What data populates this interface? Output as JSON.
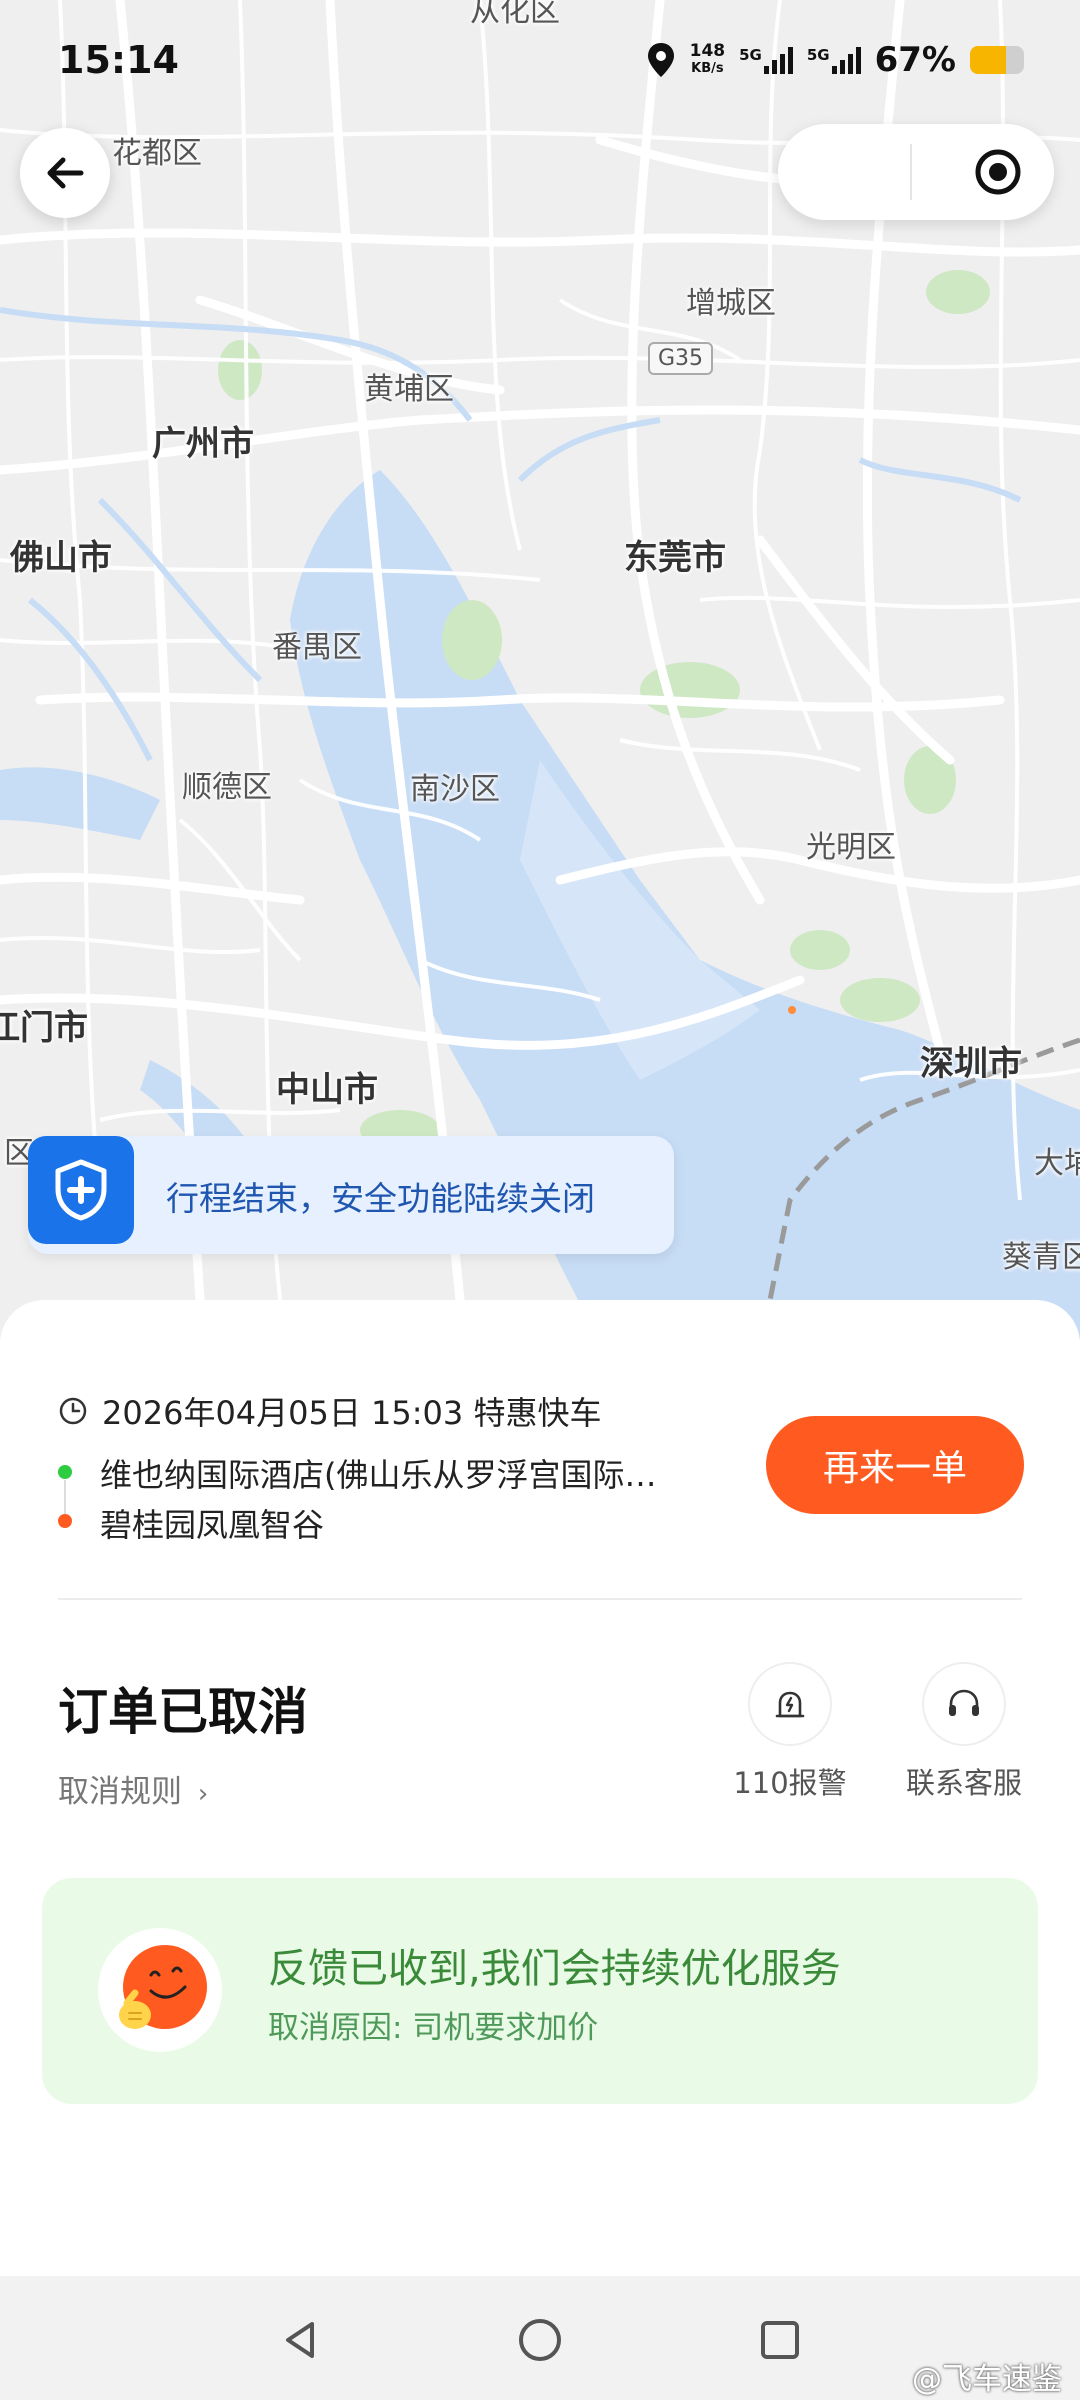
{
  "status_bar": {
    "time": "15:14",
    "net_speed_value": "148",
    "net_speed_unit": "KB/s",
    "sim1_label": "5G",
    "sim2_label": "5G",
    "battery_percent_text": "67%",
    "battery_level": 0.67,
    "battery_color": "#f7b500"
  },
  "map": {
    "labels": {
      "huadu": "花都区",
      "huadu_top": "从化区",
      "zengcheng": "增城区",
      "g35": "G35",
      "huangpu": "黄埔区",
      "guangzhou": "广州市",
      "foshan": "佛山市",
      "dongguan": "东莞市",
      "panyu": "番禺区",
      "shunde": "顺德区",
      "nansha": "南沙区",
      "guangming": "光明区",
      "jiangmen": "江门市",
      "zhongshan": "中山市",
      "shenzhen": "深圳市",
      "left_qu": "区",
      "da": "大埔",
      "kuiqing": "葵青区"
    },
    "colors": {
      "land": "#efefef",
      "water": "#c7dcf5",
      "road": "#ffffff",
      "green": "#cfe8c4",
      "border": "#9a9a9a"
    }
  },
  "nav": {
    "back_icon": "arrow-left-icon",
    "locate_icon": "locate-target-icon"
  },
  "safety_banner": {
    "icon": "shield-plus-icon",
    "text": "行程结束，安全功能陆续关闭",
    "accent": "#1a73e8"
  },
  "trip": {
    "time_icon": "clock-icon",
    "datetime_service": "2026年04月05日 15:03 特惠快车",
    "origin": "维也纳国际酒店(佛山乐从罗浮宫国际…",
    "destination": "碧桂园凤凰智谷",
    "origin_color": "#2ecc40",
    "destination_color": "#ff5a1f",
    "reorder_label": "再来一单",
    "reorder_color": "#ff5a1f"
  },
  "order": {
    "status": "订单已取消",
    "cancel_rules_label": "取消规则",
    "cancel_rules_chevron": "›",
    "actions": [
      {
        "label": "110报警",
        "icon": "alarm-siren-icon"
      },
      {
        "label": "联系客服",
        "icon": "headset-icon"
      }
    ]
  },
  "feedback": {
    "title": "反馈已收到,我们会持续优化服务",
    "reason": "取消原因: 司机要求加价",
    "mascot_icon": "smiley-mascot-icon",
    "bg_color": "#e9fbe6"
  },
  "system_nav": {
    "back_icon": "triangle-back-icon",
    "home_icon": "circle-home-icon",
    "recents_icon": "square-recents-icon"
  },
  "watermark": "@飞车速鉴"
}
